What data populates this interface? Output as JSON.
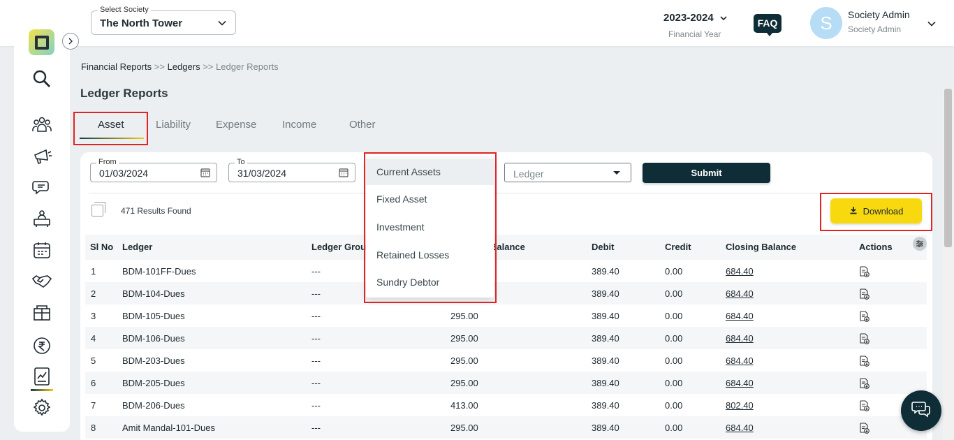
{
  "header": {
    "society_label": "Select Society",
    "society_value": "The North Tower",
    "financial_year": "2023-2024",
    "financial_year_label": "Financial Year",
    "faq": "FAQ",
    "avatar_initial": "S",
    "user_name": "Society Admin",
    "user_role": "Society Admin"
  },
  "breadcrumb": {
    "items": [
      "Financial Reports",
      "Ledgers",
      "Ledger Reports"
    ],
    "separator": ">>"
  },
  "page_title": "Ledger Reports",
  "tabs": [
    "Asset",
    "Liability",
    "Expense",
    "Income",
    "Other"
  ],
  "filters": {
    "from_label": "From",
    "from_value": "01/03/2024",
    "to_label": "To",
    "to_value": "31/03/2024",
    "ledger_placeholder": "Ledger",
    "submit": "Submit"
  },
  "dropdown": {
    "options": [
      "Current Assets",
      "Fixed Asset",
      "Investment",
      "Retained Losses",
      "Sundry Debtor"
    ],
    "selected": "Current Assets"
  },
  "results_text": "471 Results Found",
  "download": "Download",
  "table": {
    "headers": [
      "Sl No",
      "Ledger",
      "Ledger Group",
      "Opening Balance",
      "Debit",
      "Credit",
      "Closing Balance",
      "Actions"
    ],
    "header_visible": [
      "Sl No",
      "Ledger",
      "Ledger Grou",
      "Balance",
      "Debit",
      "Credit",
      "Closing Balance",
      "Actions"
    ],
    "rows": [
      {
        "sl": "1",
        "ledger": "BDM-101FF-Dues",
        "group": "---",
        "opening": "",
        "debit": "389.40",
        "credit": "0.00",
        "closing": "684.40"
      },
      {
        "sl": "2",
        "ledger": "BDM-104-Dues",
        "group": "---",
        "opening": "",
        "debit": "389.40",
        "credit": "0.00",
        "closing": "684.40"
      },
      {
        "sl": "3",
        "ledger": "BDM-105-Dues",
        "group": "---",
        "opening": "295.00",
        "debit": "389.40",
        "credit": "0.00",
        "closing": "684.40"
      },
      {
        "sl": "4",
        "ledger": "BDM-106-Dues",
        "group": "---",
        "opening": "295.00",
        "debit": "389.40",
        "credit": "0.00",
        "closing": "684.40"
      },
      {
        "sl": "5",
        "ledger": "BDM-203-Dues",
        "group": "---",
        "opening": "295.00",
        "debit": "389.40",
        "credit": "0.00",
        "closing": "684.40"
      },
      {
        "sl": "6",
        "ledger": "BDM-205-Dues",
        "group": "---",
        "opening": "295.00",
        "debit": "389.40",
        "credit": "0.00",
        "closing": "684.40"
      },
      {
        "sl": "7",
        "ledger": "BDM-206-Dues",
        "group": "---",
        "opening": "413.00",
        "debit": "389.40",
        "credit": "0.00",
        "closing": "802.40"
      },
      {
        "sl": "8",
        "ledger": "Amit Mandal-101-Dues",
        "group": "---",
        "opening": "295.00",
        "debit": "389.40",
        "credit": "0.00",
        "closing": "684.40"
      }
    ]
  },
  "sidebar_icons": [
    "search-icon",
    "members-icon",
    "announcement-icon",
    "chat-icon",
    "helpdesk-icon",
    "calendar-icon",
    "handshake-icon",
    "amenities-icon",
    "rupee-icon",
    "reports-icon",
    "settings-icon"
  ],
  "colors": {
    "primary_dark": "#0f2d36",
    "accent_yellow": "#f8d90f",
    "highlight_red": "#e02424",
    "background": "#eceff1"
  }
}
